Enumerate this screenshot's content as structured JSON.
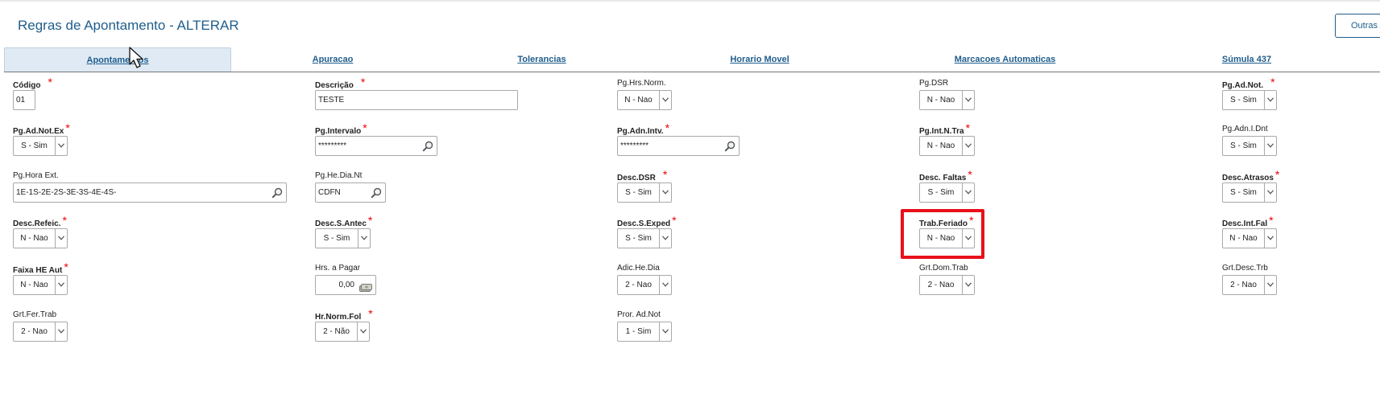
{
  "page": {
    "title": "Regras de Apontamento - ALTERAR",
    "other_actions_label": "Outras A"
  },
  "tabs": [
    {
      "label": "Apontamentos",
      "active": true
    },
    {
      "label": "Apuracao",
      "active": false
    },
    {
      "label": "Tolerancias",
      "active": false
    },
    {
      "label": "Horario Movel",
      "active": false
    },
    {
      "label": "Marcacoes Automaticas",
      "active": false
    },
    {
      "label": "Súmula 437",
      "active": false
    }
  ],
  "fields": {
    "codigo": {
      "label": "Código",
      "value": "01",
      "required": true
    },
    "descricao": {
      "label": "Descrição",
      "value": "TESTE",
      "required": true
    },
    "pg_hrs_norm": {
      "label": "Pg.Hrs.Norm.",
      "value": "N - Nao",
      "required": false
    },
    "pg_dsr": {
      "label": "Pg.DSR",
      "value": "N - Nao",
      "required": false
    },
    "pg_ad_not": {
      "label": "Pg.Ad.Not.",
      "value": "S - Sim",
      "required": true
    },
    "pg_ad_not_ex": {
      "label": "Pg.Ad.Not.Ex",
      "value": "S - Sim",
      "required": true
    },
    "pg_intervalo": {
      "label": "Pg.Intervalo",
      "value": "*********",
      "required": true
    },
    "pg_adn_intv": {
      "label": "Pg.Adn.Intv.",
      "value": "*********",
      "required": true
    },
    "pg_int_n_tra": {
      "label": "Pg.Int.N.Tra",
      "value": "N - Nao",
      "required": true
    },
    "pg_adn_i_dnt": {
      "label": "Pg.Adn.I.Dnt",
      "value": "S - Sim",
      "required": false
    },
    "pg_hora_ext": {
      "label": "Pg.Hora Ext.",
      "value": "1E-1S-2E-2S-3E-3S-4E-4S-",
      "required": false
    },
    "pg_he_dia_nt": {
      "label": "Pg.He.Dia.Nt",
      "value": "CDFN",
      "required": false
    },
    "desc_dsr": {
      "label": "Desc.DSR",
      "value": "S - Sim",
      "required": true
    },
    "desc_faltas": {
      "label": "Desc. Faltas",
      "value": "S - Sim",
      "required": true
    },
    "desc_atrasos": {
      "label": "Desc.Atrasos",
      "value": "S - Sim",
      "required": true
    },
    "desc_refeic": {
      "label": "Desc.Refeic.",
      "value": "N - Nao",
      "required": true
    },
    "desc_s_antec": {
      "label": "Desc.S.Antec",
      "value": "S - Sim",
      "required": true
    },
    "desc_s_exped": {
      "label": "Desc.S.Exped",
      "value": "S - Sim",
      "required": true
    },
    "trab_feriado": {
      "label": "Trab.Feriado",
      "value": "N - Nao",
      "required": true
    },
    "desc_int_fal": {
      "label": "Desc.Int.Fal",
      "value": "N - Nao",
      "required": true
    },
    "faixa_he_aut": {
      "label": "Faixa HE Aut",
      "value": "N - Nao",
      "required": true
    },
    "hrs_a_pagar": {
      "label": "Hrs. a Pagar",
      "value": "0,00",
      "required": false
    },
    "adic_he_dia": {
      "label": "Adic.He.Dia",
      "value": "2 - Nao",
      "required": false
    },
    "grt_dom_trab": {
      "label": "Grt.Dom.Trab",
      "value": "2 - Nao",
      "required": false
    },
    "grt_desc_trb": {
      "label": "Grt.Desc.Trb",
      "value": "2 - Nao",
      "required": false
    },
    "grt_fer_trab": {
      "label": "Grt.Fer.Trab",
      "value": "2 - Nao",
      "required": false
    },
    "hr_norm_fol": {
      "label": "Hr.Norm.Fol",
      "value": "2 - Não",
      "required": true
    },
    "pror_ad_not": {
      "label": "Pror. Ad.Not",
      "value": "1 - Sim",
      "required": false
    }
  },
  "colors": {
    "accent": "#1f5d8c",
    "required_star": "#e00000",
    "highlight_box": "#e8101a",
    "active_tab_bg": "#dfeaf4"
  },
  "icons": {
    "lookup": "magnifier-icon",
    "calculator": "money-icon",
    "dropdown": "chevron-down-icon"
  }
}
